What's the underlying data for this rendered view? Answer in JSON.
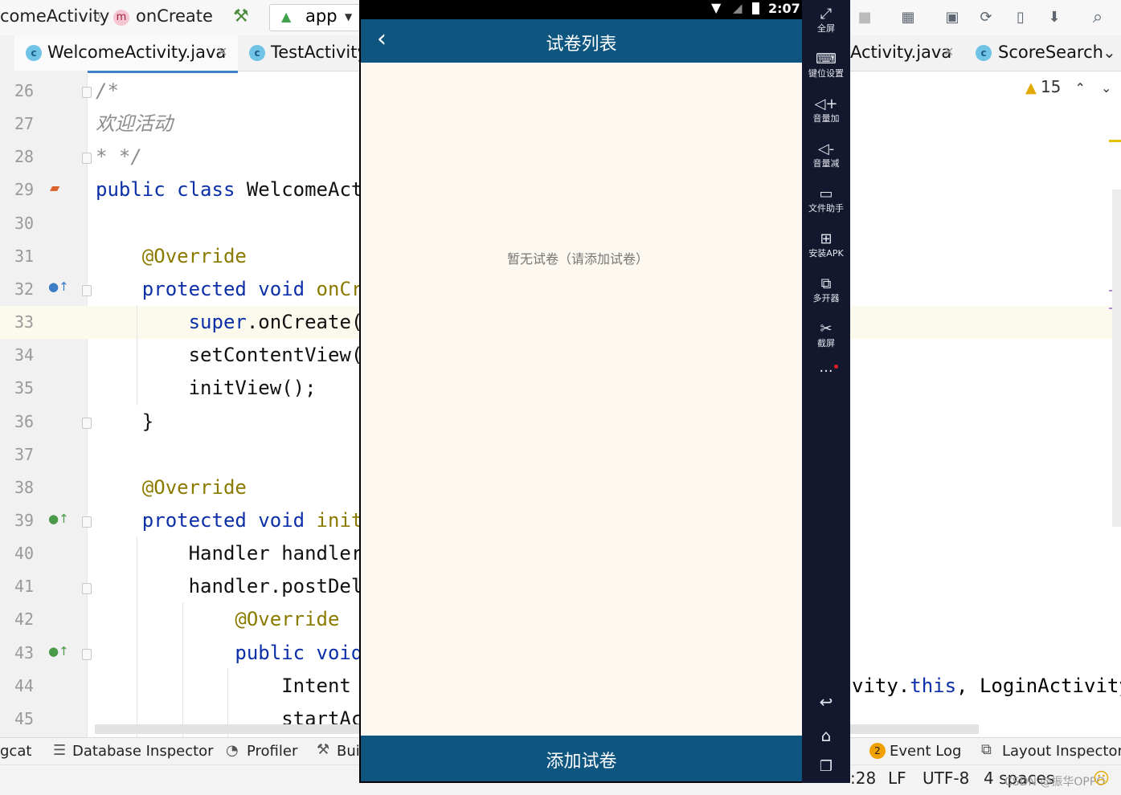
{
  "ide": {
    "breadcrumb": {
      "activity": "comeActivity",
      "method_badge": "m",
      "method": "onCreate",
      "run_config": "app"
    },
    "tabs": [
      {
        "badge": "c",
        "label": "WelcomeActivity.java"
      },
      {
        "badge": "c",
        "label": "TestActivity"
      },
      {
        "badge": "",
        "label": "Activity.java"
      },
      {
        "badge": "c",
        "label": "ScoreSearch"
      }
    ],
    "warnings": {
      "count": "15"
    },
    "lines": [
      {
        "num": "26",
        "parts": [
          {
            "t": "/*",
            "c": "cm"
          }
        ]
      },
      {
        "num": "27",
        "parts": [
          {
            "t": "欢迎活动",
            "c": "cm"
          }
        ]
      },
      {
        "num": "28",
        "parts": [
          {
            "t": "* */",
            "c": "cm"
          }
        ]
      },
      {
        "num": "29",
        "parts": [
          {
            "t": "public class ",
            "c": "kw"
          },
          {
            "t": "WelcomeActi",
            "c": ""
          }
        ]
      },
      {
        "num": "30",
        "parts": []
      },
      {
        "num": "31",
        "parts": [
          {
            "t": "    @Override",
            "c": "an"
          }
        ]
      },
      {
        "num": "32",
        "parts": [
          {
            "t": "    protected void ",
            "c": "kw"
          },
          {
            "t": "onCre",
            "c": "an"
          }
        ]
      },
      {
        "num": "33",
        "parts": [
          {
            "t": "        super",
            "c": "kw"
          },
          {
            "t": ".onCreate(s",
            "c": ""
          }
        ]
      },
      {
        "num": "34",
        "parts": [
          {
            "t": "        setContentView(R",
            "c": ""
          }
        ]
      },
      {
        "num": "35",
        "parts": [
          {
            "t": "        initView();",
            "c": ""
          }
        ]
      },
      {
        "num": "36",
        "parts": [
          {
            "t": "    }",
            "c": ""
          }
        ]
      },
      {
        "num": "37",
        "parts": []
      },
      {
        "num": "38",
        "parts": [
          {
            "t": "    @Override",
            "c": "an"
          }
        ]
      },
      {
        "num": "39",
        "parts": [
          {
            "t": "    protected void ",
            "c": "kw"
          },
          {
            "t": "initV",
            "c": "an"
          }
        ]
      },
      {
        "num": "40",
        "parts": [
          {
            "t": "        Handler handler ",
            "c": ""
          }
        ]
      },
      {
        "num": "41",
        "parts": [
          {
            "t": "        handler.postDela",
            "c": ""
          }
        ]
      },
      {
        "num": "42",
        "parts": [
          {
            "t": "            @Override",
            "c": "an"
          }
        ]
      },
      {
        "num": "43",
        "parts": [
          {
            "t": "            public void ",
            "c": "kw"
          }
        ]
      },
      {
        "num": "44",
        "parts": [
          {
            "t": "                Intent i",
            "c": ""
          }
        ]
      },
      {
        "num": "45",
        "parts": [
          {
            "t": "                startAct",
            "c": ""
          }
        ]
      }
    ],
    "right_code": {
      "a": "vity.",
      "b": "this",
      "c": ", LoginActivity"
    },
    "bottom_tools": [
      {
        "label": "gcat"
      },
      {
        "label": "Database Inspector"
      },
      {
        "label": "Profiler"
      },
      {
        "label": "Bui"
      }
    ],
    "event_log": {
      "badge": "2",
      "label": "Event Log"
    },
    "layout_inspector": "Layout Inspector",
    "status": {
      "position": ":28",
      "line_sep": "LF",
      "encoding": "UTF-8",
      "indent": "4 spaces",
      "watermark": "CSDN @振华OPPO"
    }
  },
  "phone": {
    "time": "2:07",
    "title": "试卷列表",
    "empty_text": "暂无试卷（请添加试卷）",
    "add_button": "添加试卷"
  },
  "emulator": {
    "buttons": [
      {
        "icon": "fullscreen-icon",
        "label": "全屏"
      },
      {
        "icon": "keyboard-icon",
        "label": "键位设置"
      },
      {
        "icon": "volume-up-icon",
        "label": "音量加"
      },
      {
        "icon": "volume-down-icon",
        "label": "音量减"
      },
      {
        "icon": "file-helper-icon",
        "label": "文件助手"
      },
      {
        "icon": "install-apk-icon",
        "label": "安装APK"
      },
      {
        "icon": "multi-instance-icon",
        "label": "多开器"
      },
      {
        "icon": "screenshot-icon",
        "label": "截屏"
      }
    ]
  }
}
